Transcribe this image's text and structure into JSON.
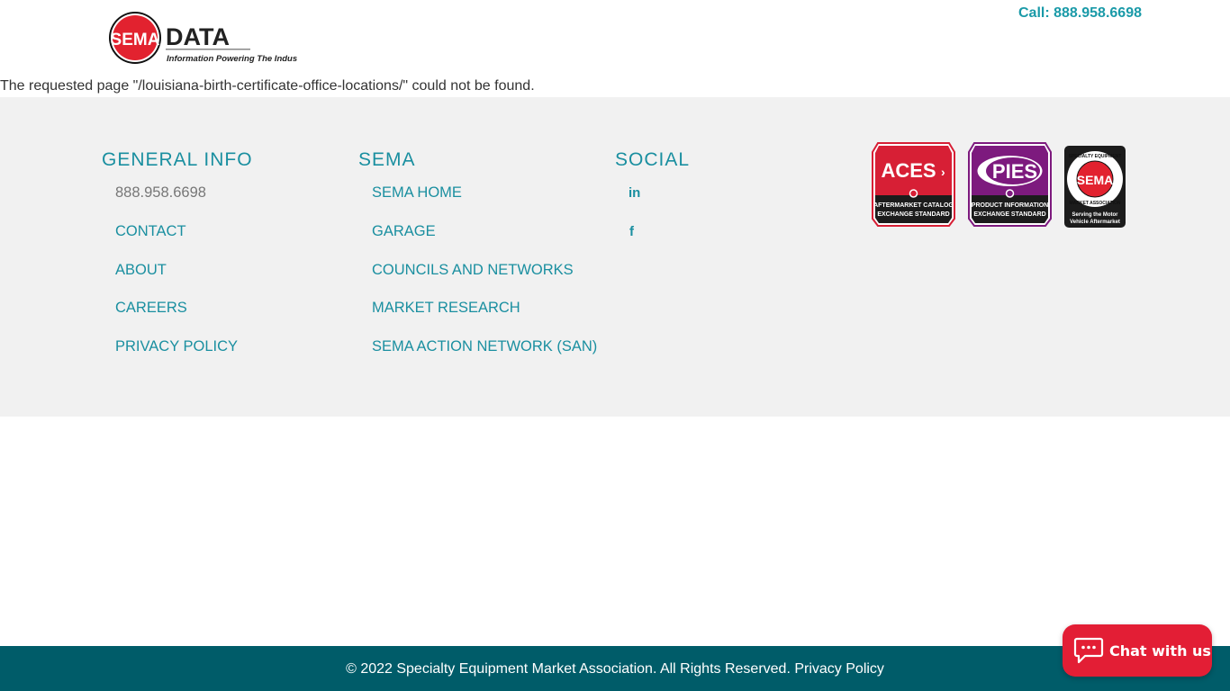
{
  "header": {
    "logo": {
      "emblem_text": "SEMA",
      "word": "DATA",
      "tagline": "Information Powering The Industry"
    },
    "call_label": "Call: 888.958.6698"
  },
  "message": "The requested page \"/louisiana-birth-certificate-office-locations/\" could not be found.",
  "footer": {
    "columns": [
      {
        "title": "GENERAL INFO",
        "items": [
          {
            "label": "888.958.6698",
            "type": "text"
          },
          {
            "label": "CONTACT",
            "type": "link"
          },
          {
            "label": "ABOUT",
            "type": "link"
          },
          {
            "label": "CAREERS",
            "type": "link"
          },
          {
            "label": "PRIVACY POLICY",
            "type": "link"
          }
        ]
      },
      {
        "title": "SEMA",
        "items": [
          {
            "label": "SEMA HOME"
          },
          {
            "label": "GARAGE"
          },
          {
            "label": "COUNCILS AND NETWORKS"
          },
          {
            "label": "MARKET RESEARCH"
          },
          {
            "label": "SEMA ACTION NETWORK (SAN)"
          }
        ]
      },
      {
        "title": "SOCIAL",
        "items": [
          {
            "icon": "linkedin-icon",
            "glyph": "in"
          },
          {
            "icon": "facebook-icon",
            "glyph": "f"
          }
        ]
      }
    ],
    "badges": {
      "aces": {
        "title": "ACES",
        "line1": "AFTERMARKET CATALOG",
        "line2": "EXCHANGE STANDARD",
        "color": "#d71f35"
      },
      "pies": {
        "title": "PIES",
        "line1": "PRODUCT INFORMATION",
        "line2": "EXCHANGE STANDARD",
        "color": "#7d1a7e"
      },
      "sema": {
        "emblem": "SEMA",
        "ring_top": "SPECIALTY EQUIPMENT",
        "ring_bottom": "MARKET ASSOCIATION",
        "line1": "Serving the Motor",
        "line2": "Vehicle Aftermarket"
      }
    },
    "copyright": "© 2022 Specialty Equipment Market Association. All Rights Reserved.",
    "privacy_link": "Privacy Policy"
  },
  "chat": {
    "label": "Chat with us"
  },
  "colors": {
    "accent": "#1a8fa0",
    "footer_bg": "#f1f1f1",
    "bottom_bar": "#005c69",
    "chat_red": "#e31e35"
  }
}
